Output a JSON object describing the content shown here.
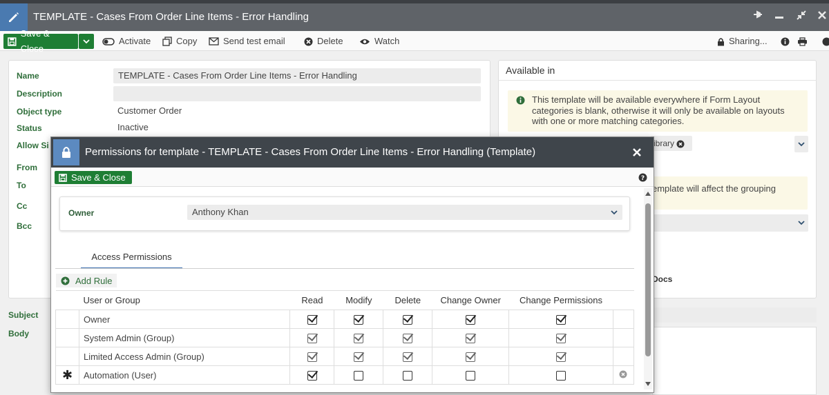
{
  "window": {
    "title": "TEMPLATE - Cases From Order Line Items - Error Handling"
  },
  "toolbar": {
    "save_close": "Save & Close",
    "activate": "Activate",
    "copy": "Copy",
    "send_test_email": "Send test email",
    "delete": "Delete",
    "watch": "Watch",
    "sharing": "Sharing..."
  },
  "form": {
    "name_label": "Name",
    "name_value": "TEMPLATE - Cases From Order Line Items - Error Handling",
    "description_label": "Description",
    "description_value": "",
    "object_type_label": "Object type",
    "object_type_value": "Customer Order",
    "status_label": "Status",
    "status_value": "Inactive",
    "allow_label": "Allow Si",
    "from_label": "From",
    "to_label": "To",
    "cc_label": "Cc",
    "bcc_label": "Bcc",
    "subject_label": "Subject",
    "body_label": "Body"
  },
  "available_in": {
    "title": "Available in",
    "info_text": "This template will be available everywhere if Form Layout categories is blank, otherwise it will only be available on layouts with one or more matching categories.",
    "library_chip": "ibrary",
    "grouping_text": "emplate will affect the grouping",
    "docs_label": "Docs"
  },
  "dialog": {
    "title": "Permissions for template - TEMPLATE - Cases From Order Line Items - Error Handling (Template)",
    "save_close": "Save & Close",
    "owner_label": "Owner",
    "owner_value": "Anthony Khan",
    "tab_label": "Access Permissions",
    "add_rule": "Add Rule",
    "columns": {
      "user_or_group": "User or Group",
      "read": "Read",
      "modify": "Modify",
      "delete": "Delete",
      "change_owner": "Change Owner",
      "change_permissions": "Change Permissions"
    },
    "rows": [
      {
        "name": "Owner",
        "read": true,
        "modify": true,
        "delete": true,
        "change_owner": true,
        "change_permissions": true,
        "dim": false
      },
      {
        "name": "System Admin (Group)",
        "read": true,
        "modify": true,
        "delete": true,
        "change_owner": true,
        "change_permissions": true,
        "dim": true
      },
      {
        "name": "Limited Access Admin (Group)",
        "read": true,
        "modify": true,
        "delete": true,
        "change_owner": true,
        "change_permissions": true,
        "dim": true
      },
      {
        "name": "Automation (User)",
        "read": true,
        "modify": false,
        "delete": false,
        "change_owner": false,
        "change_permissions": false,
        "dim": false,
        "new": true
      }
    ]
  },
  "colors": {
    "accent_green": "#1e7e34",
    "label_green": "#2f6e3a",
    "title_bar": "#5f6368",
    "dialog_header": "#3f454b",
    "icon_blue": "#4a7ab0"
  }
}
